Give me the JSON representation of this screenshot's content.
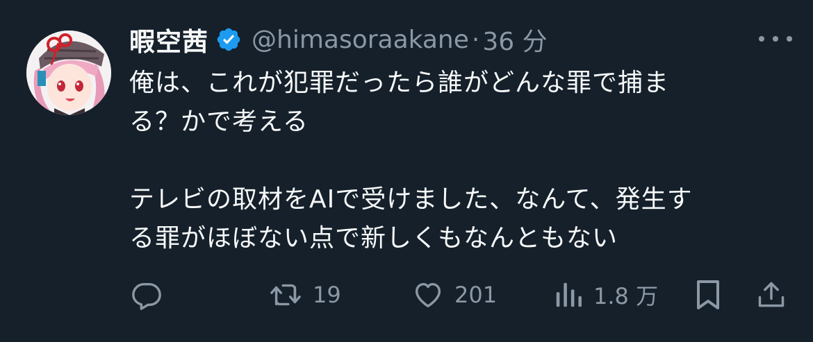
{
  "tweet": {
    "display_name": "暇空茜",
    "verified": true,
    "handle": "@himasoraakane",
    "separator": "·",
    "time": "36 分",
    "text": "俺は、これが犯罪だったら誰がどんな罪で捕ま\nる？かで考える\n\nテレビの取材をAIで受けました、なんて、発生す\nる罪がほぼない点で新しくもなんともない"
  },
  "actions": {
    "reply": {
      "icon": "reply-icon"
    },
    "retweet": {
      "icon": "retweet-icon",
      "count": "19"
    },
    "like": {
      "icon": "heart-icon",
      "count": "201"
    },
    "views": {
      "icon": "views-icon",
      "count": "1.8 万"
    },
    "bookmark": {
      "icon": "bookmark-icon"
    },
    "share": {
      "icon": "share-icon"
    }
  },
  "colors": {
    "background": "#15202b",
    "text": "#f7f9f9",
    "secondary": "#8b98a5",
    "verified": "#1d9bf0"
  }
}
